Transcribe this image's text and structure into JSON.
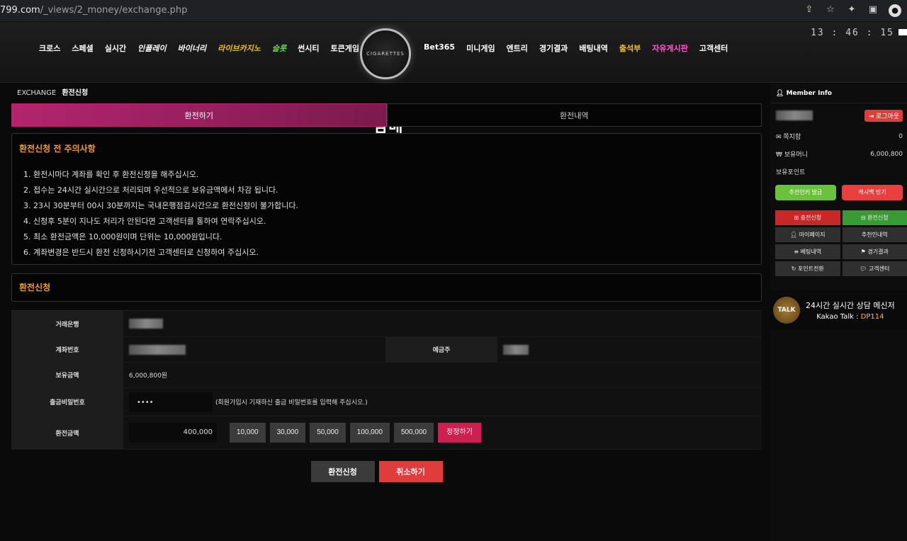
{
  "browser": {
    "host": "799.com",
    "path": "/_views/2_money/exchange.php"
  },
  "header": {
    "nav_left": [
      "크로스",
      "스페셜",
      "실시간",
      "인플레이",
      "바이너리",
      "라이브카지노",
      "슬롯",
      "썬시티",
      "토큰게임"
    ],
    "nav_right": [
      "Bet365",
      "미니게임",
      "엔트리",
      "경기결과",
      "배팅내역",
      "출석부",
      "자유게시판",
      "고객센터"
    ],
    "logo_main": "담배",
    "logo_sub": "CIGARETTES",
    "clock": "13 : 46 : 15"
  },
  "breadcrumb": {
    "section": "EXCHANGE",
    "page": "환전신청"
  },
  "tabs": {
    "active": "환전하기",
    "other": "환전내역"
  },
  "notice": {
    "title": "환전신청 전 주의사항",
    "items": [
      "1. 환전시마다 계좌를 확인 후 환전신청을 해주십시오.",
      "2. 접수는 24시간 실시간으로 처리되며 우선적으로 보유금액에서 차감 됩니다.",
      "3. 23시 30분부터 00시 30분까지는 국내은행점검시간으로 환전신청이 불가합니다.",
      "4. 신청후 5분이 지나도 처리가 안된다면 고객센터를 통하여 연락주십시오.",
      "5. 최소 환전금액은 10,000원이며 단위는 10,000원입니다.",
      "6. 계좌변경은 반드시 환전 신청하시기전 고객센터로 신청하여 주십시오."
    ]
  },
  "form": {
    "section_title": "환전신청",
    "bank_label": "거래은행",
    "account_label": "계좌번호",
    "holder_label": "예금주",
    "balance_label": "보유금액",
    "balance_value": "6,000,800원",
    "password_label": "출금비밀번호",
    "password_value": "••••",
    "password_hint": "(회원가입시 기재하신 출금 비밀번호를 입력해 주십시오.)",
    "amount_label": "환전금액",
    "amount_value": "400,000",
    "amount_buttons": [
      "10,000",
      "30,000",
      "50,000",
      "100,000",
      "500,000"
    ],
    "reset_label": "정정하기",
    "submit_label": "환전신청",
    "cancel_label": "취소하기"
  },
  "sidebar": {
    "title": "Member Info",
    "logout": "로그아웃",
    "message_label": "쪽지함",
    "message_count": "0",
    "money_label": "보유머니",
    "money_value": "6,000,800",
    "point_label": "보유포인트",
    "gift_code": "추천인키 발급",
    "cashback": "캐시백 받기",
    "quick": [
      "충전신청",
      "환전신청",
      "마이페이지",
      "추천인내역",
      "베팅내역",
      "경기결과",
      "포인트전환",
      "고객센터"
    ],
    "talk_badge": "TALK",
    "talk_line1": "24시간 실시간 상담 메신저",
    "talk_prefix": "Kakao Talk : ",
    "talk_id": "DP114"
  }
}
